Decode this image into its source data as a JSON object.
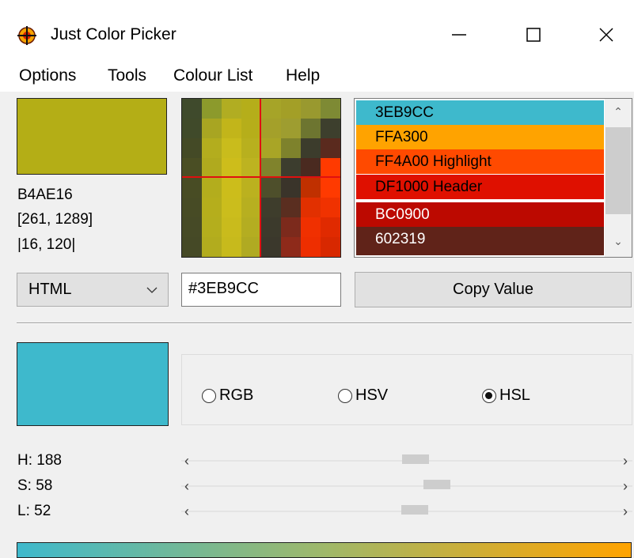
{
  "window": {
    "title": "Just Color Picker",
    "icon": "crosshair-target-icon",
    "controls": [
      "minimize-icon",
      "maximize-icon",
      "close-icon"
    ]
  },
  "menu": {
    "items": [
      "Options",
      "Tools",
      "Colour List",
      "Help"
    ]
  },
  "picked": {
    "color": "#B4AE16",
    "hex": "B4AE16",
    "coords": "[261, 1289]",
    "relative": "|16, 120|"
  },
  "colour_list": {
    "items": [
      {
        "label": "3EB9CC",
        "bg": "#3EB9CC",
        "fg": "#000000"
      },
      {
        "label": "FFA300",
        "bg": "#FFA300",
        "fg": "#000000"
      },
      {
        "label": "FF4A00 Highlight",
        "bg": "#FF4A00",
        "fg": "#000000"
      },
      {
        "label": "DF1000 Header",
        "bg": "#DF1000",
        "fg": "#000000"
      },
      {
        "label": "BC0900",
        "bg": "#BC0900",
        "fg": "#ffffff"
      },
      {
        "label": "602319",
        "bg": "#602319",
        "fg": "#ffffff"
      }
    ]
  },
  "format": {
    "selected": "HTML",
    "value": "#3EB9CC",
    "copy_label": "Copy Value"
  },
  "current": {
    "color": "#3EB9CC",
    "modes": [
      "RGB",
      "HSV",
      "HSL"
    ],
    "selected_mode": "HSL"
  },
  "sliders": [
    {
      "label": "H: 188",
      "value": 188,
      "max": 360
    },
    {
      "label": "S: 58",
      "value": 58,
      "max": 100
    },
    {
      "label": "L: 52",
      "value": 52,
      "max": 100
    }
  ]
}
